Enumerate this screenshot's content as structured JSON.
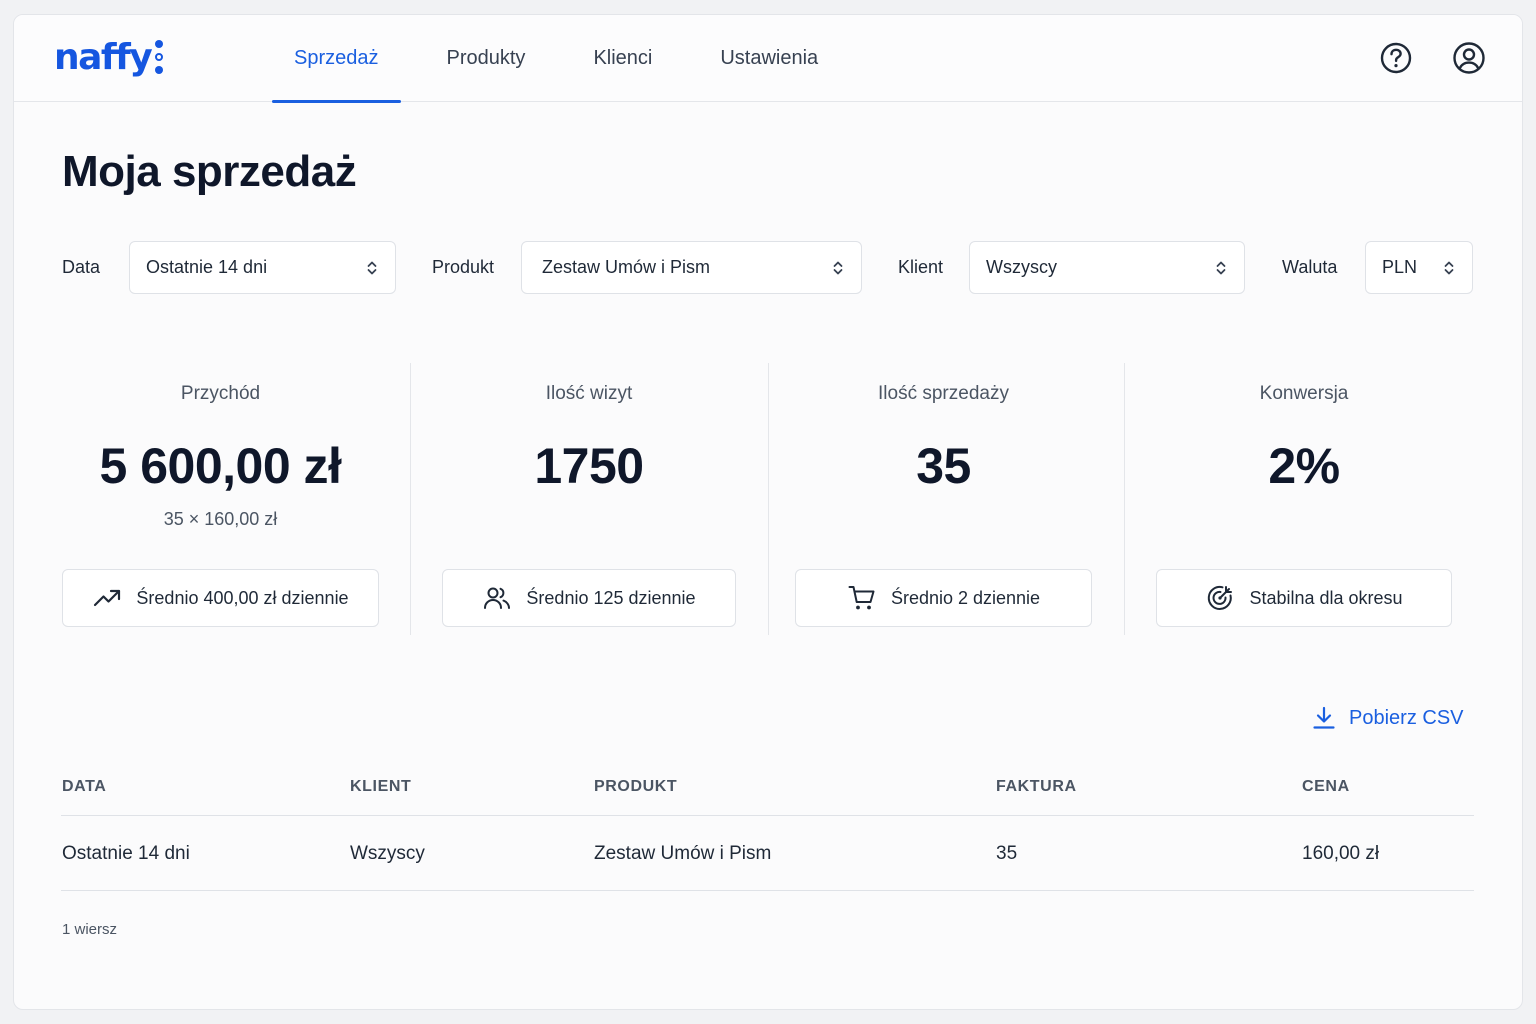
{
  "header": {
    "logo": "naffy",
    "nav": [
      {
        "label": "Sprzedaż",
        "active": true
      },
      {
        "label": "Produkty",
        "active": false
      },
      {
        "label": "Klienci",
        "active": false
      },
      {
        "label": "Ustawienia",
        "active": false
      }
    ],
    "icons": [
      "help-icon",
      "user-icon"
    ],
    "accent_color": "#1a5fe0"
  },
  "page": {
    "title": "Moja sprzedaż"
  },
  "filters": {
    "date": {
      "label": "Data",
      "value": "Ostatnie 14 dni"
    },
    "product": {
      "label": "Produkt",
      "value": "Zestaw Umów i Pism"
    },
    "client": {
      "label": "Klient",
      "value": "Wszyscy"
    },
    "currency": {
      "label": "Waluta",
      "value": "PLN"
    }
  },
  "stats": [
    {
      "label": "Przychód",
      "value": "5 600,00 zł",
      "sub": "35 × 160,00 zł",
      "chip": "Średnio 400,00 zł dziennie",
      "icon": "trending-up-icon"
    },
    {
      "label": "Ilość wizyt",
      "value": "1750",
      "sub": "",
      "chip": "Średnio 125 dziennie",
      "icon": "users-icon"
    },
    {
      "label": "Ilość sprzedaży",
      "value": "35",
      "sub": "",
      "chip": "Średnio 2 dziennie",
      "icon": "cart-icon"
    },
    {
      "label": "Konwersja",
      "value": "2%",
      "sub": "",
      "chip": "Stabilna dla okresu",
      "icon": "target-icon"
    }
  ],
  "download": {
    "label": "Pobierz CSV",
    "icon": "download-icon"
  },
  "table": {
    "columns": [
      "DATA",
      "KLIENT",
      "PRODUKT",
      "FAKTURA",
      "CENA"
    ],
    "rows": [
      [
        "Ostatnie 14 dni",
        "Wszyscy",
        "Zestaw Umów i Pism",
        "35",
        "160,00 zł"
      ]
    ],
    "row_count": "1 wiersz"
  }
}
